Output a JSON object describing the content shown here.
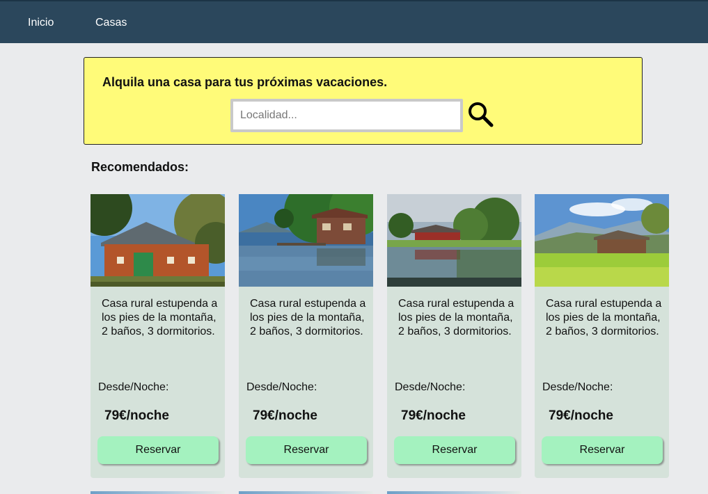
{
  "nav": {
    "home": "Inicio",
    "houses": "Casas"
  },
  "search": {
    "title": "Alquila una casa para tus próximas vacaciones.",
    "placeholder": "Localidad..."
  },
  "recommended_title": "Recomendados:",
  "cards": [
    {
      "description": "Casa rural estupenda a los pies de la montaña, 2 baños, 3 dormitorios.",
      "from_label": "Desde/Noche:",
      "price": "79€/noche",
      "button": "Reservar"
    },
    {
      "description": "Casa rural estupenda a los pies de la montaña, 2 baños, 3 dormitorios.",
      "from_label": "Desde/Noche:",
      "price": "79€/noche",
      "button": "Reservar"
    },
    {
      "description": "Casa rural estupenda a los pies de la montaña, 2 baños, 3 dormitorios.",
      "from_label": "Desde/Noche:",
      "price": "79€/noche",
      "button": "Reservar"
    },
    {
      "description": "Casa rural estupenda a los pies de la montaña, 2 baños, 3 dormitorios.",
      "from_label": "Desde/Noche:",
      "price": "79€/noche",
      "button": "Reservar"
    }
  ],
  "colors": {
    "navbar": "#2b475c",
    "search_banner": "#fffb79",
    "card_bg": "#d5e2da",
    "button": "#a4f2bf"
  },
  "icons": {
    "search": "search-icon"
  }
}
